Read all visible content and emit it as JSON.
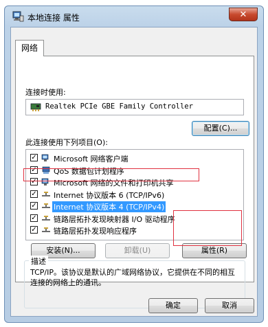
{
  "window": {
    "title": "本地连接 属性",
    "close_glyph": "✕"
  },
  "tab": {
    "label": "网络"
  },
  "connect_using": {
    "label": "连接时使用:",
    "adapter_name": "Realtek PCIe GBE Family Controller",
    "configure_button": "配置(C)..."
  },
  "items_section": {
    "label": "此连接使用下列项目(O):",
    "items": [
      {
        "label": "Microsoft 网络客户端",
        "checked": true,
        "icon": "network-client-icon"
      },
      {
        "label": "QoS 数据包计划程序",
        "checked": true,
        "icon": "qos-icon"
      },
      {
        "label": "Microsoft 网络的文件和打印机共享",
        "checked": true,
        "icon": "file-share-icon"
      },
      {
        "label": "Internet 协议版本 6 (TCP/IPv6)",
        "checked": true,
        "icon": "protocol-icon"
      },
      {
        "label": "Internet 协议版本 4 (TCP/IPv4)",
        "checked": true,
        "icon": "protocol-icon",
        "selected": true
      },
      {
        "label": "链路层拓扑发现映射器 I/O 驱动程序",
        "checked": true,
        "icon": "protocol-icon"
      },
      {
        "label": "链路层拓扑发现响应程序",
        "checked": true,
        "icon": "protocol-icon"
      }
    ],
    "check_glyph": "✓"
  },
  "buttons": {
    "install": "安装(N)...",
    "uninstall": "卸载(U)",
    "properties": "属性(R)",
    "ok": "确定",
    "cancel": "取消"
  },
  "description": {
    "title": "描述",
    "text": "TCP/IP。该协议是默认的广域网络协议，它提供在不同的相互连接的网络上的通讯。"
  },
  "colors": {
    "selection": "#3399ff",
    "annotation_red": "#e0303f"
  }
}
